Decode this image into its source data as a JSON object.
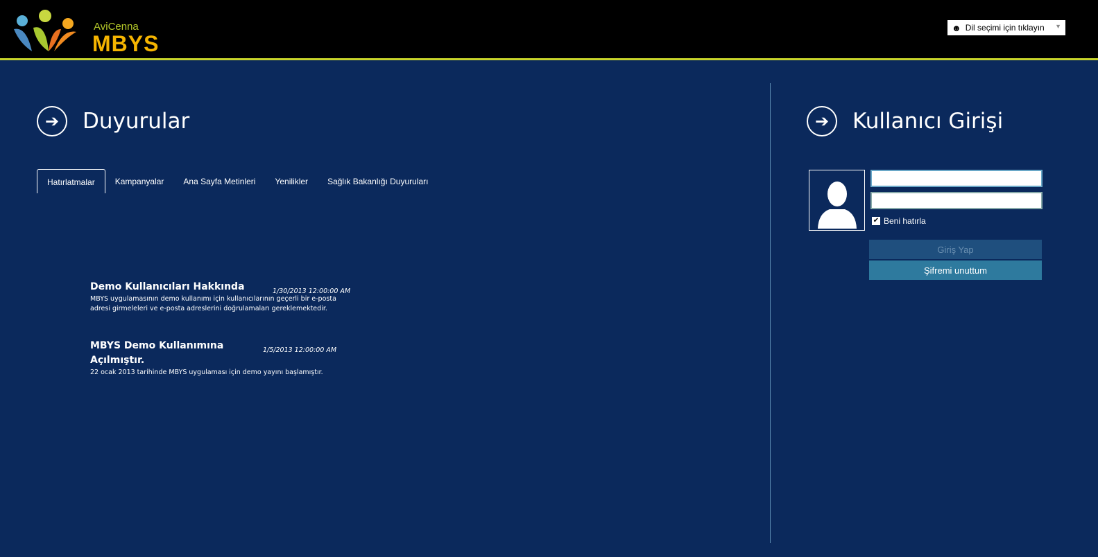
{
  "header": {
    "logo_top": "AviCenna",
    "logo_main": "MBYS",
    "language_selector": "Dil seçimi için tıklayın"
  },
  "announcements": {
    "title": "Duyurular",
    "tabs": [
      "Hatırlatmalar",
      "Kampanyalar",
      "Ana Sayfa Metinleri",
      "Yenilikler",
      "Sağlık Bakanlığı Duyuruları"
    ],
    "items": [
      {
        "title": "Demo Kullanıcıları Hakkında",
        "date": "1/30/2013 12:00:00 AM",
        "body": "MBYS uygulamasının demo kullanımı için kullanıcılarının geçerli bir e-posta adresi girmeleleri ve e-posta adreslerini doğrulamaları gereklemektedir."
      },
      {
        "title": "MBYS Demo Kullanımına Açılmıştır.",
        "date": "1/5/2013 12:00:00 AM",
        "body": "22 ocak 2013 tarihinde MBYS uygulaması için demo yayını başlamıştır."
      }
    ]
  },
  "login": {
    "title": "Kullanıcı Girişi",
    "username": "",
    "password": "",
    "remember_label": "Beni hatırla",
    "remember_checked": true,
    "login_button": "Giriş Yap",
    "forgot_button": "Şifremi unuttum"
  },
  "colors": {
    "background": "#0b295c",
    "accent_line": "#c8d42a",
    "login_button": "#1f4f7e",
    "forgot_button": "#2e7a9e"
  }
}
